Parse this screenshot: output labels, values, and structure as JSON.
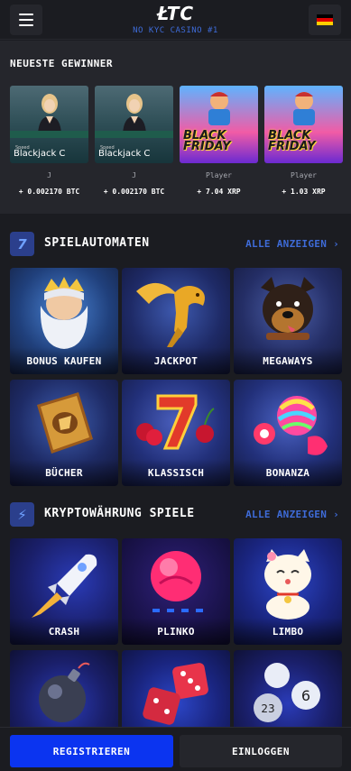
{
  "header": {
    "logo": "ŁTC",
    "tagline": "NO KYC CASINO #1",
    "menu_icon": "hamburger-menu-icon",
    "language_flag": "german-flag-icon"
  },
  "winners": {
    "title": "NEUESTE GEWINNER",
    "items": [
      {
        "game_label_small": "Speed",
        "game_label": "Blackjack C",
        "game_sub": "Live",
        "player": "J",
        "amount": "+ 0.002170 BTC"
      },
      {
        "game_label_small": "Speed",
        "game_label": "Blackjack C",
        "game_sub": "Live",
        "player": "J",
        "amount": "+ 0.002170 BTC"
      },
      {
        "game_label": "BLACK FRIDAY",
        "player": "Player",
        "amount": "+ 7.04 XRP"
      },
      {
        "game_label": "BLACK FRIDAY",
        "player": "Player",
        "amount": "+ 1.03 XRP"
      }
    ]
  },
  "slots": {
    "icon_glyph": "7",
    "title": "SPIELAUTOMATEN",
    "link": "ALLE ANZEIGEN",
    "tiles": [
      {
        "label": "BONUS KAUFEN"
      },
      {
        "label": "JACKPOT"
      },
      {
        "label": "MEGAWAYS"
      },
      {
        "label": "BÜCHER"
      },
      {
        "label": "KLASSISCH"
      },
      {
        "label": "BONANZA"
      }
    ]
  },
  "crypto": {
    "icon_glyph": "⚡",
    "title": "KRYPTOWÄHRUNG SPIELE",
    "link": "ALLE ANZEIGEN",
    "tiles": [
      {
        "label": "CRASH"
      },
      {
        "label": "PLINKO"
      },
      {
        "label": "LIMBO"
      },
      {
        "label": ""
      },
      {
        "label": ""
      },
      {
        "label": ""
      }
    ]
  },
  "bottom": {
    "register": "REGISTRIEREN",
    "login": "EINLOGGEN"
  },
  "colors": {
    "accent": "#3e6bd8",
    "register_button": "#0b34f0",
    "panel": "#25262c",
    "background": "#1b1c21"
  }
}
